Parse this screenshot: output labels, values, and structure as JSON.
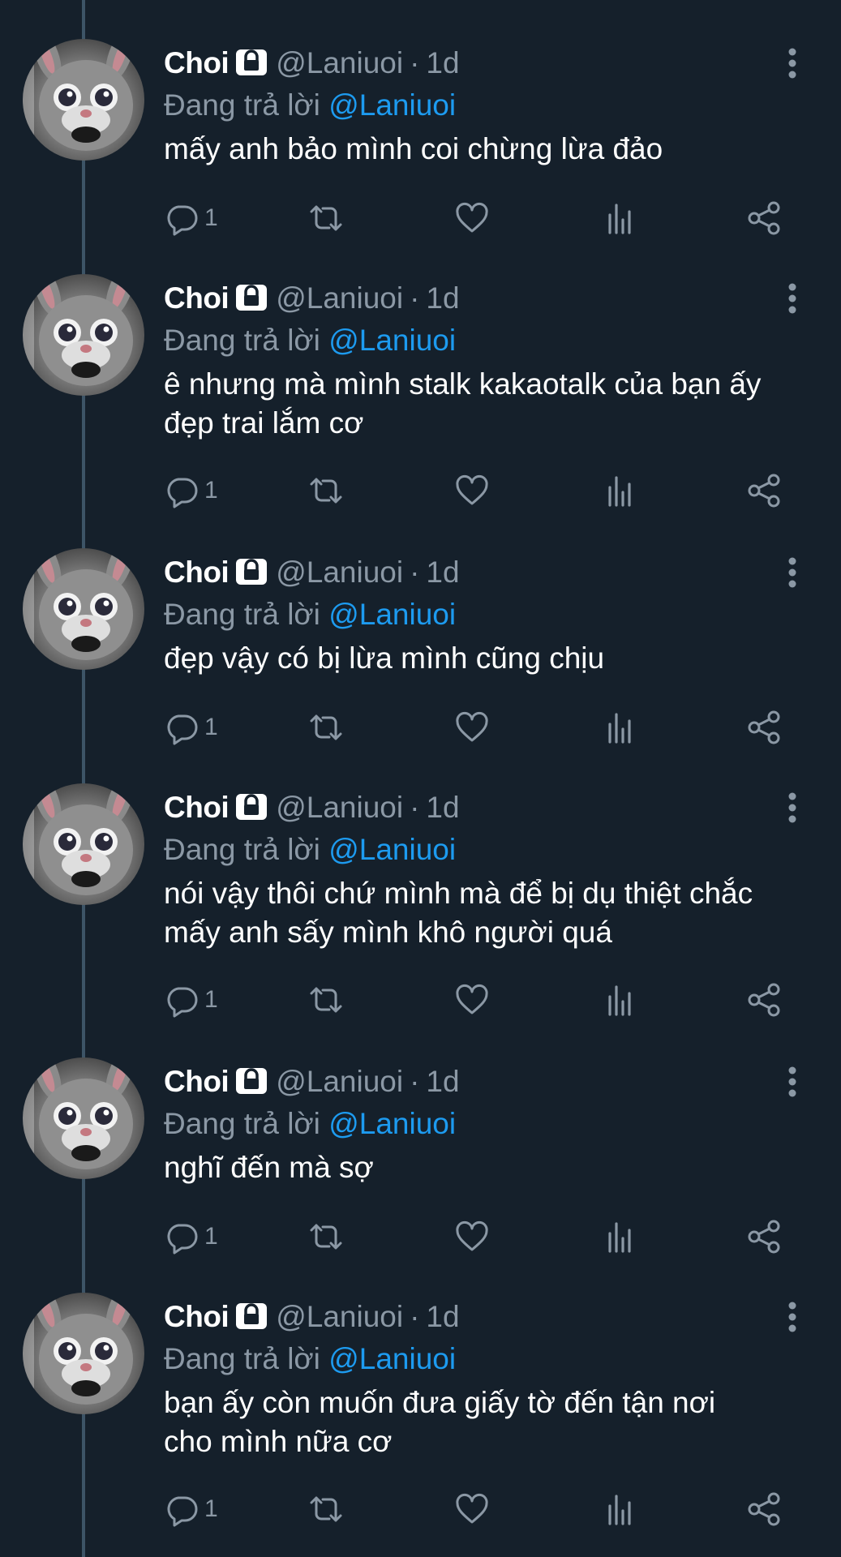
{
  "tweets": [
    {
      "name": "Choi",
      "handle": "@Laniuoi",
      "separator": "·",
      "time": "1d",
      "replying_prefix": "Đang trả lời",
      "replying_to": "@Laniuoi",
      "text": "mấy anh bảo mình coi chừng lừa đảo",
      "reply_count": "1"
    },
    {
      "name": "Choi",
      "handle": "@Laniuoi",
      "separator": "·",
      "time": "1d",
      "replying_prefix": "Đang trả lời",
      "replying_to": "@Laniuoi",
      "text_line1": "ê nhưng mà mình stalk kakaotalk của bạn ấy",
      "text_line2": "đẹp trai lắm cơ",
      "reply_count": "1"
    },
    {
      "name": "Choi",
      "handle": "@Laniuoi",
      "separator": "·",
      "time": "1d",
      "replying_prefix": "Đang trả lời",
      "replying_to": "@Laniuoi",
      "text": "đẹp vậy có bị lừa mình cũng chịu",
      "reply_count": "1"
    },
    {
      "name": "Choi",
      "handle": "@Laniuoi",
      "separator": "·",
      "time": "1d",
      "replying_prefix": "Đang trả lời",
      "replying_to": "@Laniuoi",
      "text_line1": "nói vậy thôi chứ mình mà để bị dụ thiệt chắc",
      "text_line2": "mấy anh sấy mình khô người quá",
      "reply_count": "1"
    },
    {
      "name": "Choi",
      "handle": "@Laniuoi",
      "separator": "·",
      "time": "1d",
      "replying_prefix": "Đang trả lời",
      "replying_to": "@Laniuoi",
      "text": "nghĩ đến mà sợ",
      "reply_count": "1"
    },
    {
      "name": "Choi",
      "handle": "@Laniuoi",
      "separator": "·",
      "time": "1d",
      "replying_prefix": "Đang trả lời",
      "replying_to": "@Laniuoi",
      "text_line1": "bạn ấy còn muốn đưa giấy tờ đến tận nơi",
      "text_line2": "cho mình nữa cơ",
      "reply_count": "1"
    }
  ],
  "icons": {
    "lock": "lock-icon",
    "more": "more-vertical-icon",
    "reply": "reply-icon",
    "retweet": "retweet-icon",
    "like": "heart-icon",
    "views": "views-chart-icon",
    "share": "share-icon"
  },
  "colors": {
    "background": "#15202b",
    "muted": "#8b98a5",
    "accent": "#1d9bf0",
    "text": "#ffffff",
    "thread_line": "#3d5466"
  }
}
